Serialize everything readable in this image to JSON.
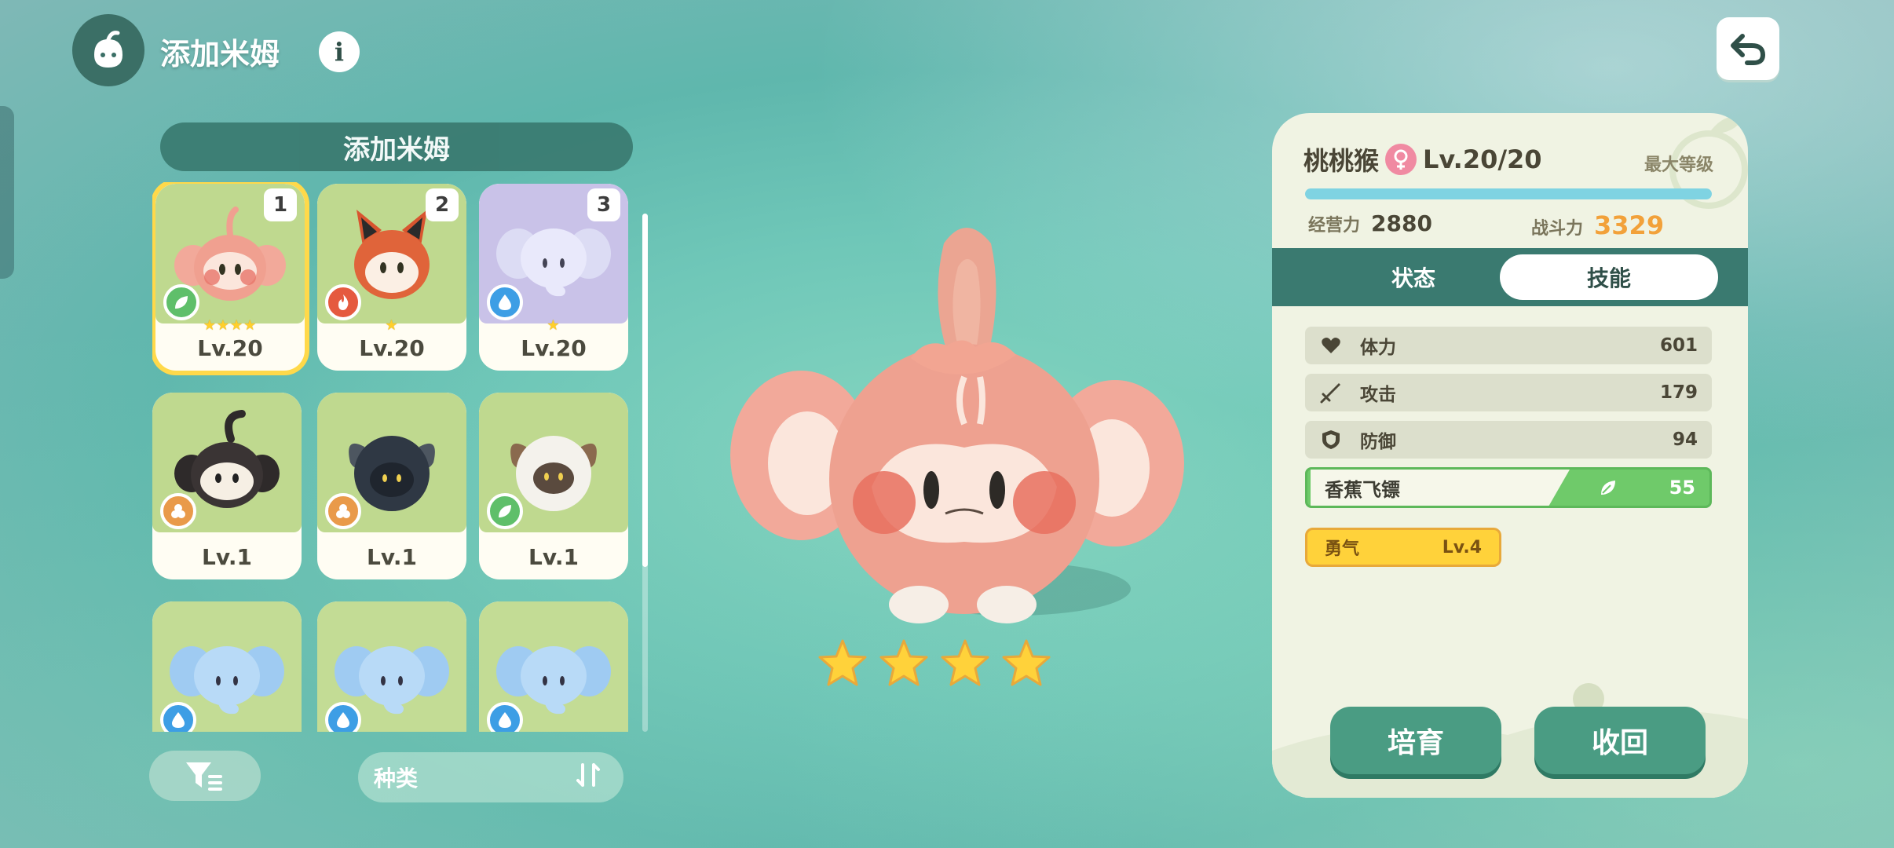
{
  "header": {
    "title": "添加米姆",
    "info_icon": "info-icon",
    "back_icon": "undo-arrow-icon"
  },
  "list": {
    "title": "添加米姆",
    "cards": [
      {
        "slot": "1",
        "level": "Lv.20",
        "element": "grass",
        "stars": "★★★★",
        "creature": "peach-monkey"
      },
      {
        "slot": "2",
        "level": "Lv.20",
        "element": "fire",
        "stars": "★",
        "creature": "fox"
      },
      {
        "slot": "3",
        "level": "Lv.20",
        "element": "water",
        "stars": "★",
        "creature": "elephant-purple"
      },
      {
        "slot": "",
        "level": "Lv.1",
        "element": "earth",
        "stars": "",
        "creature": "black-monkey"
      },
      {
        "slot": "",
        "level": "Lv.1",
        "element": "earth",
        "stars": "",
        "creature": "black-sheep"
      },
      {
        "slot": "",
        "level": "Lv.1",
        "element": "grass",
        "stars": "",
        "creature": "white-sheep"
      },
      {
        "slot": "",
        "level": "",
        "element": "water",
        "stars": "",
        "creature": "blue-elephant"
      },
      {
        "slot": "",
        "level": "",
        "element": "water",
        "stars": "",
        "creature": "blue-elephant"
      },
      {
        "slot": "",
        "level": "",
        "element": "water",
        "stars": "",
        "creature": "blue-elephant"
      }
    ],
    "filter_icon": "filter-icon",
    "sort_label": "种类",
    "sort_icon": "sort-icon"
  },
  "preview": {
    "star_count": 4
  },
  "detail": {
    "name": "桃桃猴",
    "gender": "female",
    "level": "Lv.20/20",
    "max_level_label": "最大等级",
    "exp_fill": 1.0,
    "business_label": "经营力",
    "business_value": "2880",
    "power_label": "战斗力",
    "power_value": "3329",
    "tabs": [
      "状态",
      "技能"
    ],
    "active_tab": "技能",
    "attributes": [
      {
        "icon": "heart-icon",
        "label": "体力",
        "value": "601"
      },
      {
        "icon": "sword-icon",
        "label": "攻击",
        "value": "179"
      },
      {
        "icon": "shield-icon",
        "label": "防御",
        "value": "94"
      }
    ],
    "skill": {
      "label": "香蕉飞镖",
      "value": "55",
      "icon": "leaf-icon"
    },
    "trait": {
      "label": "勇气",
      "level": "Lv.4"
    },
    "buttons": {
      "train": "培育",
      "recall": "收回"
    }
  }
}
